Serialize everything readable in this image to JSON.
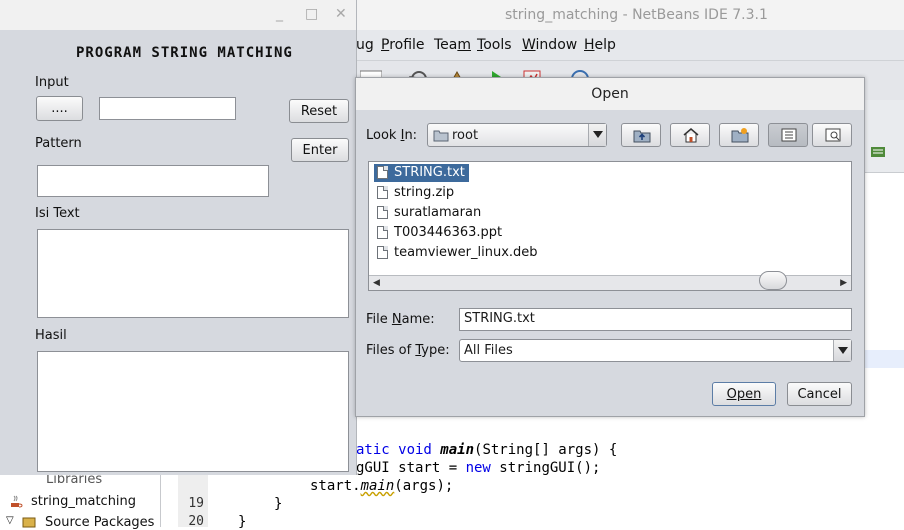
{
  "netbeans": {
    "title": "string_matching - NetBeans IDE 7.3.1",
    "menu": [
      {
        "label": "ug",
        "mn": ""
      },
      {
        "label": "Profile",
        "mn": "P"
      },
      {
        "label": "Team",
        "mn": "m"
      },
      {
        "label": "Tools",
        "mn": "T"
      },
      {
        "label": "Window",
        "mn": "W"
      },
      {
        "label": "Help",
        "mn": "H"
      }
    ],
    "code": {
      "line1_kw": "atic void ",
      "line1_method": "main",
      "line1_rest": "(String[] args) {",
      "line2_pre": "gGUI start = ",
      "line2_kw": "new",
      "line2_rest": " stringGUI();",
      "line3_pre": "start.",
      "line3_method": "main",
      "line3_rest": "(args);",
      "line4": "}",
      "line5": "}"
    },
    "gutter": [
      "19",
      "20"
    ],
    "tree": {
      "partial": "Libraries",
      "project": "string_matching",
      "source": "Source Packages"
    }
  },
  "app": {
    "minimize": "_",
    "maximize": "□",
    "close": "✕",
    "heading": "PROGRAM STRING MATCHING",
    "input_label": "Input",
    "browse_label": "....",
    "input_value": "",
    "reset_label": "Reset",
    "pattern_label": "Pattern",
    "enter_label": "Enter",
    "pattern_value": "",
    "isi_label": "Isi Text",
    "hasil_label": "Hasil"
  },
  "dialog": {
    "title": "Open",
    "look_in_label": "Look In:",
    "look_in_mn": "I",
    "look_in_value": "root",
    "files": [
      "STRING.txt",
      "string.zip",
      "suratlamaran",
      "T003446363.ppt",
      "teamviewer_linux.deb"
    ],
    "selected_index": 0,
    "file_name_label": "File Name:",
    "file_name_mn": "N",
    "file_name_value": "STRING.txt",
    "files_type_label": "Files of Type:",
    "files_type_mn": "T",
    "files_type_value": "All Files",
    "open_label": "Open",
    "cancel_label": "Cancel"
  },
  "colors": {
    "selection": "#3d6a9c",
    "keyword": "#0000e6",
    "panel": "#d6d9df"
  }
}
